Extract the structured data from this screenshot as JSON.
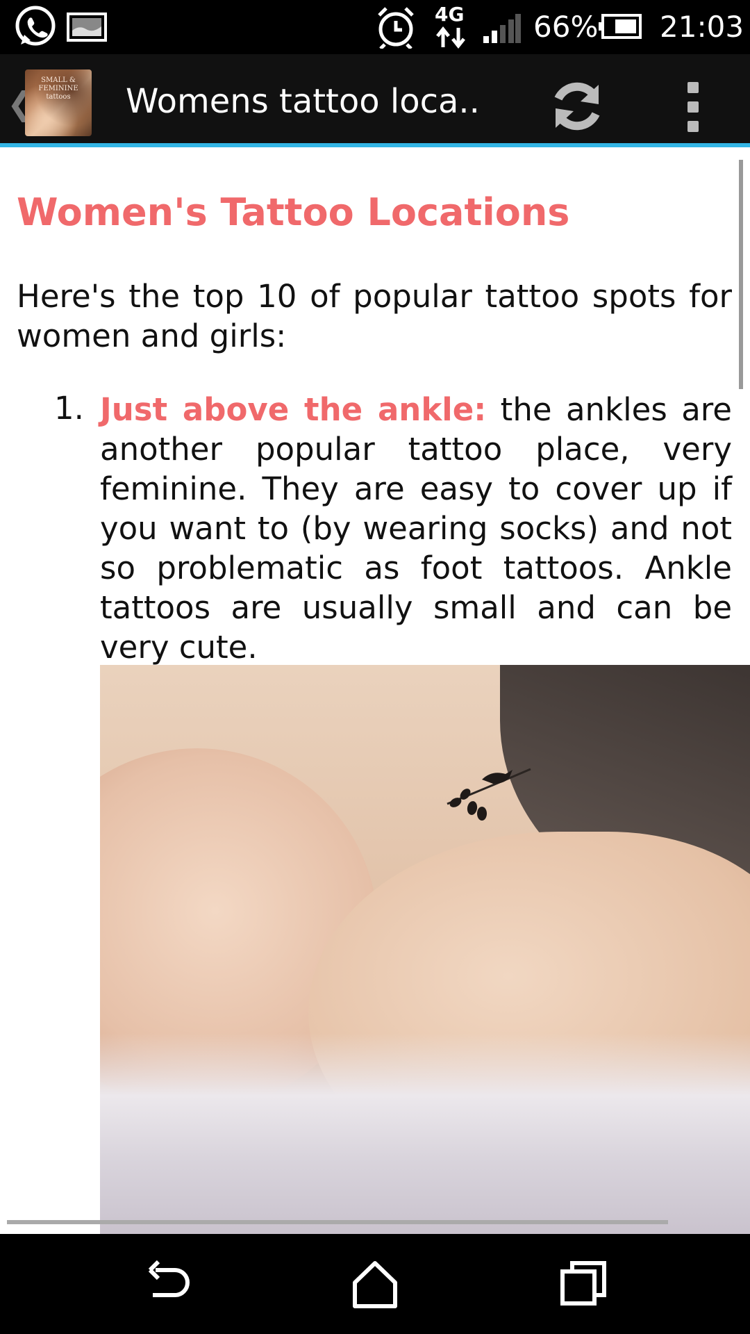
{
  "status_bar": {
    "network": "4G",
    "battery": "66%",
    "time": "21:03",
    "icons": [
      "whatsapp-icon",
      "gallery-icon",
      "alarm-icon",
      "network-4g-icon",
      "signal-icon",
      "battery-icon"
    ]
  },
  "action_bar": {
    "title": "Womens tattoo loca..",
    "app_icon_caption": "SMALL & FEMININE tattoos",
    "accent_color": "#33b5e5",
    "icons": [
      "up-caret-icon",
      "refresh-icon",
      "overflow-menu-icon"
    ]
  },
  "content": {
    "heading": "Women's Tattoo Locations",
    "intro": "Here's the top 10 of popular tattoo spots for women and girls:",
    "list": [
      {
        "number": "1.",
        "highlight": "Just above the ankle:",
        "text": " the ankles are another popular tattoo place, very feminine. They are easy to cover up if you want to (by wearing socks) and not so problematic as foot tattoos. Ankle tattoos are usually small and can be very cute."
      }
    ],
    "heading_color": "#f0696b"
  },
  "nav_bar": {
    "icons": [
      "back-icon",
      "home-icon",
      "recents-icon"
    ]
  }
}
